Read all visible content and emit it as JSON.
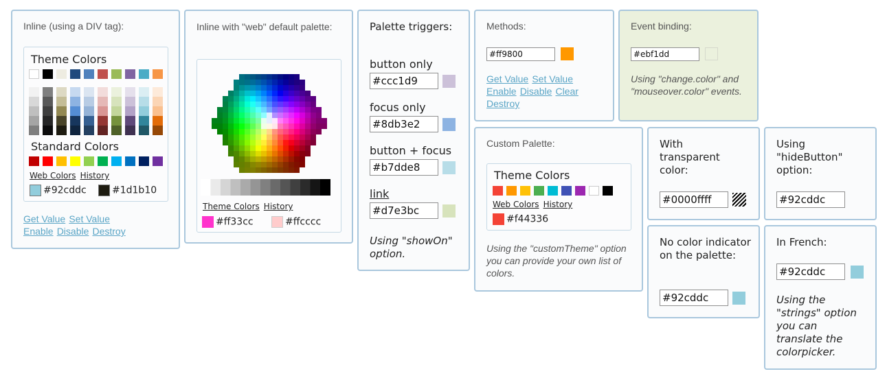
{
  "panel_inline": {
    "title": "Inline (using a DIV tag):",
    "theme_colors_label": "Theme Colors",
    "theme_row": [
      "#ffffff",
      "#000000",
      "#eeece1",
      "#1f497d",
      "#4f81bd",
      "#c0504d",
      "#9bbb59",
      "#8064a2",
      "#4bacc6",
      "#f79646"
    ],
    "theme_shades": [
      [
        "#f2f2f2",
        "#d8d8d8",
        "#bfbfbf",
        "#a5a5a5",
        "#7f7f7f"
      ],
      [
        "#7f7f7f",
        "#595959",
        "#3f3f3f",
        "#262626",
        "#0c0c0c"
      ],
      [
        "#ddd9c3",
        "#c4bd97",
        "#938953",
        "#494429",
        "#1d1b10"
      ],
      [
        "#c6d9f0",
        "#8db3e2",
        "#548dd4",
        "#17365d",
        "#0f243e"
      ],
      [
        "#dbe5f1",
        "#b8cce4",
        "#95b3d7",
        "#366092",
        "#244061"
      ],
      [
        "#f2dcdb",
        "#e5b9b7",
        "#d99694",
        "#953734",
        "#632423"
      ],
      [
        "#ebf1dd",
        "#d7e3bc",
        "#c3d69b",
        "#76923c",
        "#4f6128"
      ],
      [
        "#e5e0ec",
        "#ccc1d9",
        "#b2a2c7",
        "#5f497a",
        "#3f3151"
      ],
      [
        "#dbeef3",
        "#b7dde8",
        "#92cddc",
        "#31859b",
        "#205867"
      ],
      [
        "#fdeada",
        "#fbd5b5",
        "#fac08f",
        "#e36c09",
        "#974806"
      ]
    ],
    "standard_colors_label": "Standard Colors",
    "standard_row": [
      "#c00000",
      "#ff0000",
      "#ffc000",
      "#ffff00",
      "#92d050",
      "#00b050",
      "#00b0f0",
      "#0070c0",
      "#002060",
      "#7030a0"
    ],
    "tab_web": "Web Colors",
    "tab_history": "History",
    "current_color": "#92cddc",
    "current_label": "#92cddc",
    "previous_color": "#1d1b10",
    "previous_label": "#1d1b10",
    "link_get": "Get Value",
    "link_set": "Set Value",
    "link_enable": "Enable",
    "link_disable": "Disable",
    "link_destroy": "Destroy"
  },
  "panel_web": {
    "title": "Inline with \"web\" default palette:",
    "tab_theme": "Theme Colors",
    "tab_history": "History",
    "current_color": "#ff33cc",
    "current_label": "#ff33cc",
    "previous_color": "#ffcccc",
    "previous_label": "#ffcccc"
  },
  "panel_triggers": {
    "title": "Palette triggers:",
    "items": [
      {
        "label": "button only",
        "value": "#ccc1d9",
        "color": "#ccc1d9"
      },
      {
        "label": "focus only",
        "value": "#8db3e2",
        "color": "#8db3e2"
      },
      {
        "label": "button + focus",
        "value": "#b7dde8",
        "color": "#b7dde8"
      },
      {
        "label": "link",
        "value": "#d7e3bc",
        "color": "#d7e3bc"
      }
    ],
    "note": "Using \"showOn\" option."
  },
  "panel_methods": {
    "title": "Methods:",
    "value": "#ff9800",
    "color": "#ff9800",
    "link_get": "Get Value",
    "link_set": "Set Value",
    "link_enable": "Enable",
    "link_disable": "Disable",
    "link_clear": "Clear",
    "link_destroy": "Destroy"
  },
  "panel_events": {
    "title": "Event binding:",
    "value": "#ebf1dd",
    "color": "#ebf1dd",
    "note": "Using \"change.color\" and \"mouseover.color\" events."
  },
  "panel_custom": {
    "title": "Custom Palette:",
    "theme_colors_label": "Theme Colors",
    "colors": [
      "#f44336",
      "#ff9800",
      "#ffc107",
      "#4caf50",
      "#00bcd4",
      "#3f51b5",
      "#9c27b0",
      "#ffffff",
      "#000000"
    ],
    "tab_web": "Web Colors",
    "tab_history": "History",
    "current_color": "#f44336",
    "current_label": "#f44336",
    "note": "Using the \"customTheme\" option you can provide your own list of colors."
  },
  "panel_transparent": {
    "title": "With transparent color:",
    "value": "#0000ffff"
  },
  "panel_hidebutton": {
    "title": "Using \"hideButton\" option:",
    "value": "#92cddc"
  },
  "panel_noindicator": {
    "title": "No color indicator on the palette:",
    "value": "#92cddc",
    "color": "#92cddc"
  },
  "panel_french": {
    "title": "In French:",
    "value": "#92cddc",
    "color": "#92cddc",
    "note": "Using the \"strings\" option you can translate the colorpicker."
  }
}
